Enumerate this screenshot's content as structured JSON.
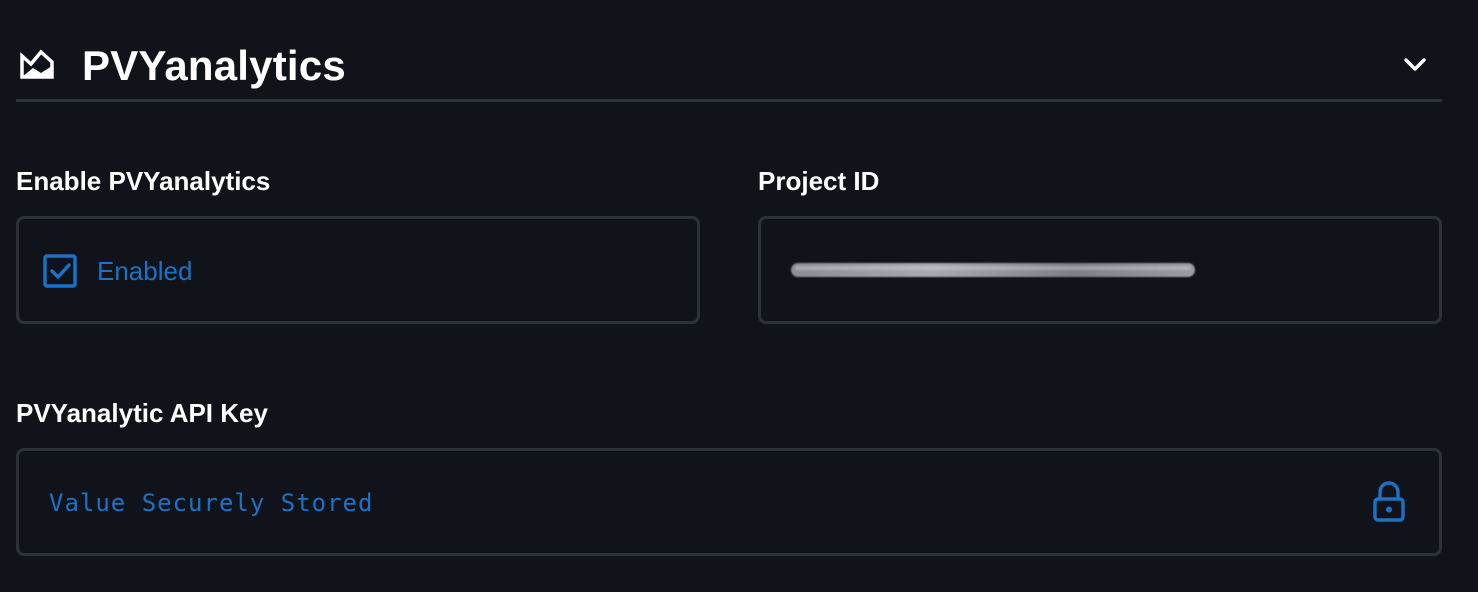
{
  "header": {
    "title": "PVYanalytics",
    "icon": "analytics-chart-icon",
    "collapse_icon": "chevron-down-icon"
  },
  "enable_section": {
    "label": "Enable PVYanalytics",
    "checkbox_label": "Enabled",
    "checked": true
  },
  "project_section": {
    "label": "Project ID",
    "value_redacted": true
  },
  "api_key_section": {
    "label": "PVYanalytic API Key",
    "value": "Value Securely Stored",
    "icon": "lock-icon"
  },
  "colors": {
    "background": "#10131a",
    "border": "#2d3139",
    "accent": "#1a73c9",
    "text": "#ffffff"
  }
}
